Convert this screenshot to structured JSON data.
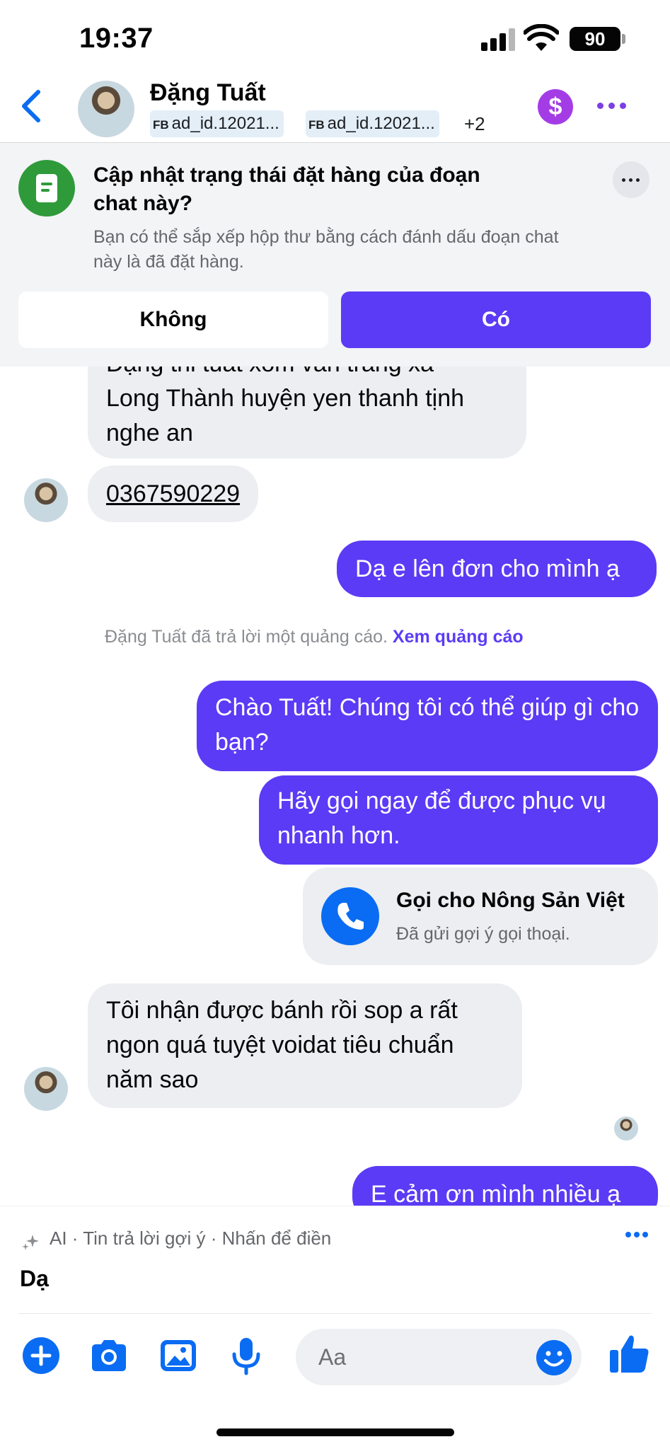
{
  "status_bar": {
    "time": "19:37",
    "battery": "90"
  },
  "header": {
    "contact_name": "Đặng Tuất",
    "ad_chip_prefix": "FB",
    "ad_chips": [
      "ad_id.12021...",
      "ad_id.12021..."
    ],
    "more_count": "+2",
    "dollar_label": "$"
  },
  "banner": {
    "title": "Cập nhật trạng thái đặt hàng của đoạn chat này?",
    "description": "Bạn có thể sắp xếp hộp thư bằng cách đánh dấu đoạn chat này là đã đặt hàng.",
    "no_label": "Không",
    "yes_label": "Có"
  },
  "messages": {
    "address_partial": "Đặng thi tuat xom van trang xa",
    "address_line2": "Long Thành huyện yen thanh tịnh",
    "address_line3": "nghe an",
    "phone": "0367590229",
    "reply_order": "Dạ e lên đơn cho mình ạ",
    "system_text": "Đặng Tuất đã trả lời một quảng cáo.",
    "system_link": "Xem quảng cáo",
    "greeting": "Chào Tuất! Chúng tôi có thể giúp gì cho bạn?",
    "call_prompt": "Hãy gọi ngay để được phục vụ nhanh hơn.",
    "call_card_title": "Gọi cho Nông Sản Việt",
    "call_card_subtitle": "Đã gửi gợi ý gọi thoại.",
    "customer_feedback": "Tôi nhận được bánh rồi sop a rất ngon quá tuyệt voidat tiêu chuẩn năm sao",
    "thanks_partial": "E cảm ơn mình nhiều ạ"
  },
  "ai_bar": {
    "label": "AI · Tin trả lời gợi ý · Nhấn để điền",
    "suggestion": "Dạ"
  },
  "composer": {
    "placeholder": "Aa"
  },
  "colors": {
    "accent": "#5b3bf5",
    "blue": "#0a6cf2",
    "dollar": "#a43ce6",
    "order_icon": "#2f9a3a"
  },
  "icons": [
    "back-chevron-icon",
    "dollar-icon",
    "more-dots-icon",
    "order-doc-icon",
    "phone-icon",
    "ai-sparkle-icon",
    "plus-icon",
    "camera-icon",
    "image-icon",
    "microphone-icon",
    "emoji-icon",
    "thumbs-up-icon"
  ]
}
